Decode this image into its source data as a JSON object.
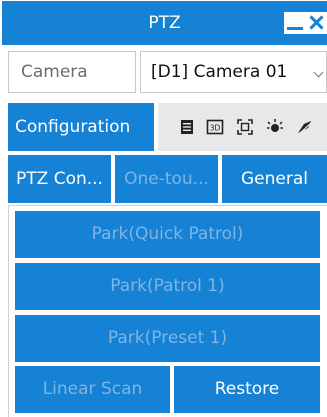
{
  "window": {
    "title": "PTZ",
    "minimize_icon": "minimize-icon",
    "close_icon": "close-icon"
  },
  "camera": {
    "label": "Camera",
    "selected": "[D1] Camera 01"
  },
  "toolbar": {
    "configuration_label": "Configuration",
    "icons": [
      "menu-icon",
      "3d-icon",
      "focus-frame-icon",
      "light-icon",
      "wiper-icon"
    ]
  },
  "tabs": [
    {
      "label": "PTZ Con...",
      "state": "enabled"
    },
    {
      "label": "One-tou...",
      "state": "disabled"
    },
    {
      "label": "General",
      "state": "enabled"
    }
  ],
  "actions": {
    "park_quick_patrol": "Park(Quick Patrol)",
    "park_patrol_1": "Park(Patrol 1)",
    "park_preset_1": "Park(Preset 1)",
    "linear_scan": "Linear Scan",
    "restore": "Restore"
  },
  "colors": {
    "accent": "#1582d6",
    "disabled_text": "#7fb4e3",
    "icon_strip": "#e8e8e8"
  }
}
